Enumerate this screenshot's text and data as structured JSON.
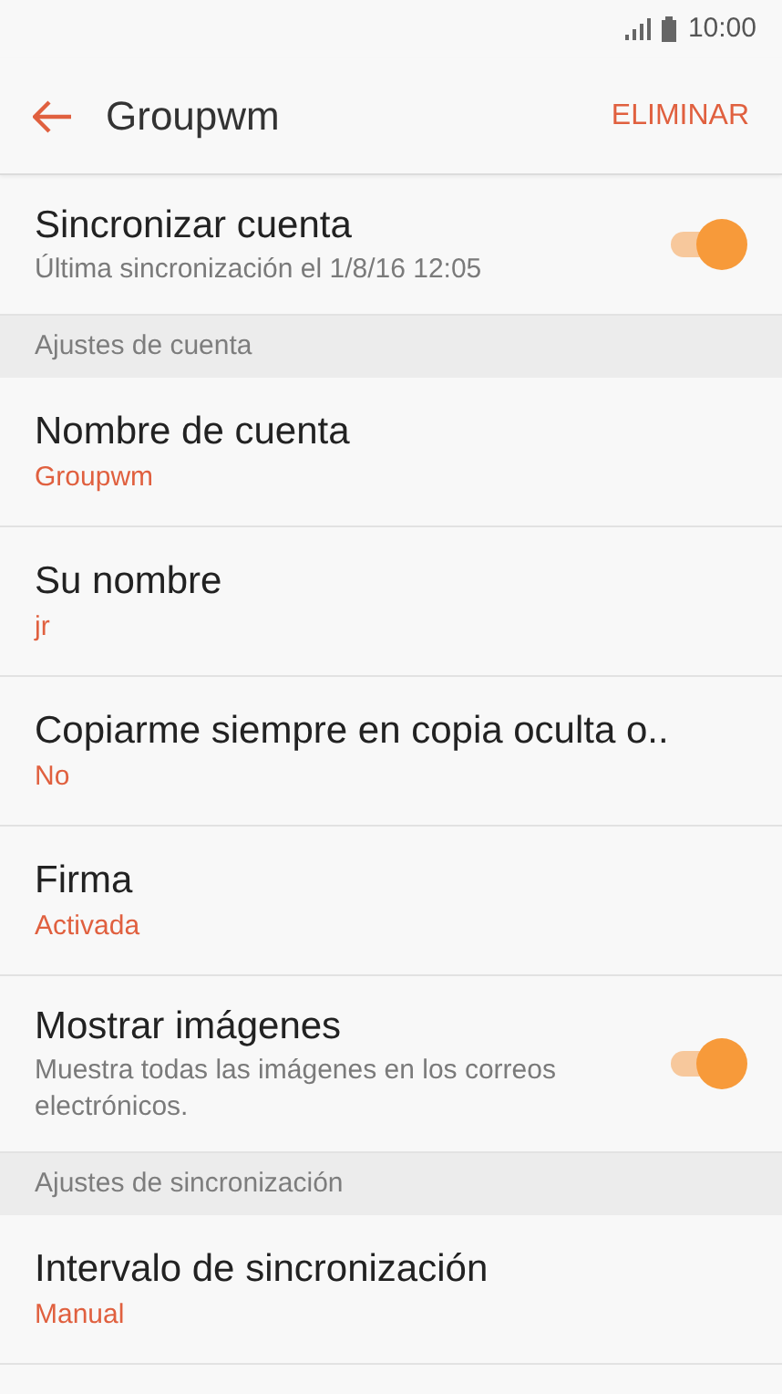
{
  "status_bar": {
    "time": "10:00"
  },
  "header": {
    "title": "Groupwm",
    "action": "ELIMINAR"
  },
  "rows": [
    {
      "kind": "toggle",
      "title": "Sincronizar cuenta",
      "subtitle": "Última sincronización el 1/8/16  12:05",
      "on": true
    },
    {
      "kind": "header",
      "title": "Ajustes de cuenta"
    },
    {
      "kind": "value",
      "title": "Nombre de cuenta",
      "value": "Groupwm"
    },
    {
      "kind": "value",
      "title": "Su nombre",
      "value": "jr"
    },
    {
      "kind": "value",
      "title": "Copiarme siempre en copia oculta o..",
      "value": "No"
    },
    {
      "kind": "value",
      "title": "Firma",
      "value": "Activada"
    },
    {
      "kind": "toggle",
      "title": "Mostrar imágenes",
      "subtitle": "Muestra todas las imágenes en los correos electrónicos.",
      "on": true
    },
    {
      "kind": "header",
      "title": "Ajustes de sincronización"
    },
    {
      "kind": "value",
      "title": "Intervalo de sincronización",
      "value": "Manual"
    }
  ]
}
